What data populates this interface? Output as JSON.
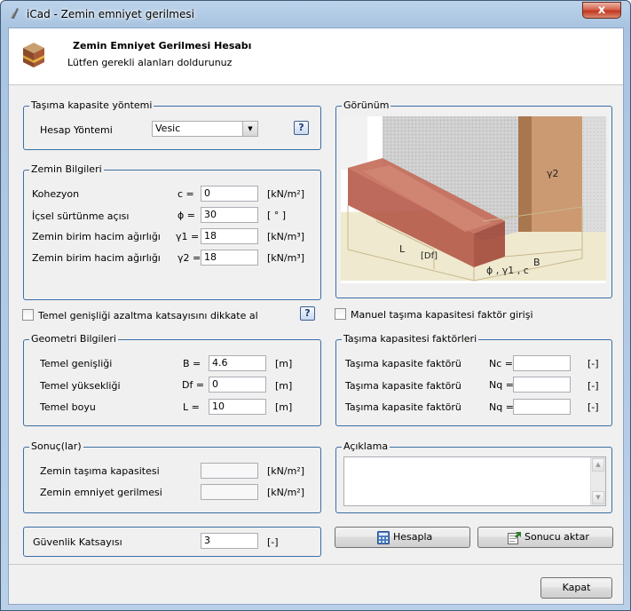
{
  "window": {
    "title": "iCad - Zemin emniyet gerilmesi",
    "close_glyph": "x"
  },
  "header": {
    "title": "Zemin Emniyet Gerilmesi Hesabı",
    "subtitle": "Lütfen gerekli alanları doldurunuz"
  },
  "method": {
    "legend": "Taşıma kapasite yöntemi",
    "label": "Hesap Yöntemi",
    "value": "Vesic",
    "help": "?"
  },
  "soil": {
    "legend": "Zemin Bilgileri",
    "rows": [
      {
        "label": "Kohezyon",
        "symbol": "c =",
        "value": "0",
        "unit": "[kN/m²]"
      },
      {
        "label": "İçsel sürtünme açısı",
        "symbol": "ϕ =",
        "value": "30",
        "unit": "[ ° ]"
      },
      {
        "label": "Zemin birim hacim ağırlığı",
        "symbol": "γ1 =",
        "value": "18",
        "unit": "[kN/m³]"
      },
      {
        "label": "Zemin birim hacim ağırlığı",
        "symbol": "γ2 =",
        "value": "18",
        "unit": "[kN/m³]"
      }
    ]
  },
  "width_reduction": {
    "label": "Temel genişliği azaltma katsayısını dikkate al",
    "help": "?"
  },
  "geometry": {
    "legend": "Geometri Bilgileri",
    "rows": [
      {
        "label": "Temel genişliği",
        "symbol": "B =",
        "value": "4.6",
        "unit": "[m]"
      },
      {
        "label": "Temel yüksekliği",
        "symbol": "Df =",
        "value": "0",
        "unit": "[m]"
      },
      {
        "label": "Temel boyu",
        "symbol": "L =",
        "value": "10",
        "unit": "[m]"
      }
    ]
  },
  "results": {
    "legend": "Sonuç(lar)",
    "rows": [
      {
        "label": "Zemin taşıma kapasitesi",
        "value": "",
        "unit": "[kN/m²]"
      },
      {
        "label": "Zemin emniyet gerilmesi",
        "value": "",
        "unit": "[kN/m²]"
      }
    ]
  },
  "safety": {
    "label": "Güvenlik Katsayısı",
    "value": "3",
    "unit": "[-]"
  },
  "preview": {
    "legend": "Görünüm",
    "labels": {
      "gamma2": "γ2",
      "L": "L",
      "Df": "[Df]",
      "params": "ϕ , γ1 , c",
      "B": "B"
    }
  },
  "manual_factors": {
    "label": "Manuel taşıma kapasitesi faktör girişi"
  },
  "factors": {
    "legend": "Taşıma kapasitesi faktörleri",
    "rows": [
      {
        "label": "Taşıma kapasite faktörü",
        "symbol": "Nc =",
        "value": "",
        "unit": "[-]"
      },
      {
        "label": "Taşıma kapasite faktörü",
        "symbol": "Nq =",
        "value": "",
        "unit": "[-]"
      },
      {
        "label": "Taşıma kapasite faktörü",
        "symbol": "Nq =",
        "value": "",
        "unit": "[-]"
      }
    ]
  },
  "notes": {
    "legend": "Açıklama",
    "value": ""
  },
  "buttons": {
    "calculate": "Hesapla",
    "export": "Sonucu aktar",
    "close": "Kapat"
  }
}
